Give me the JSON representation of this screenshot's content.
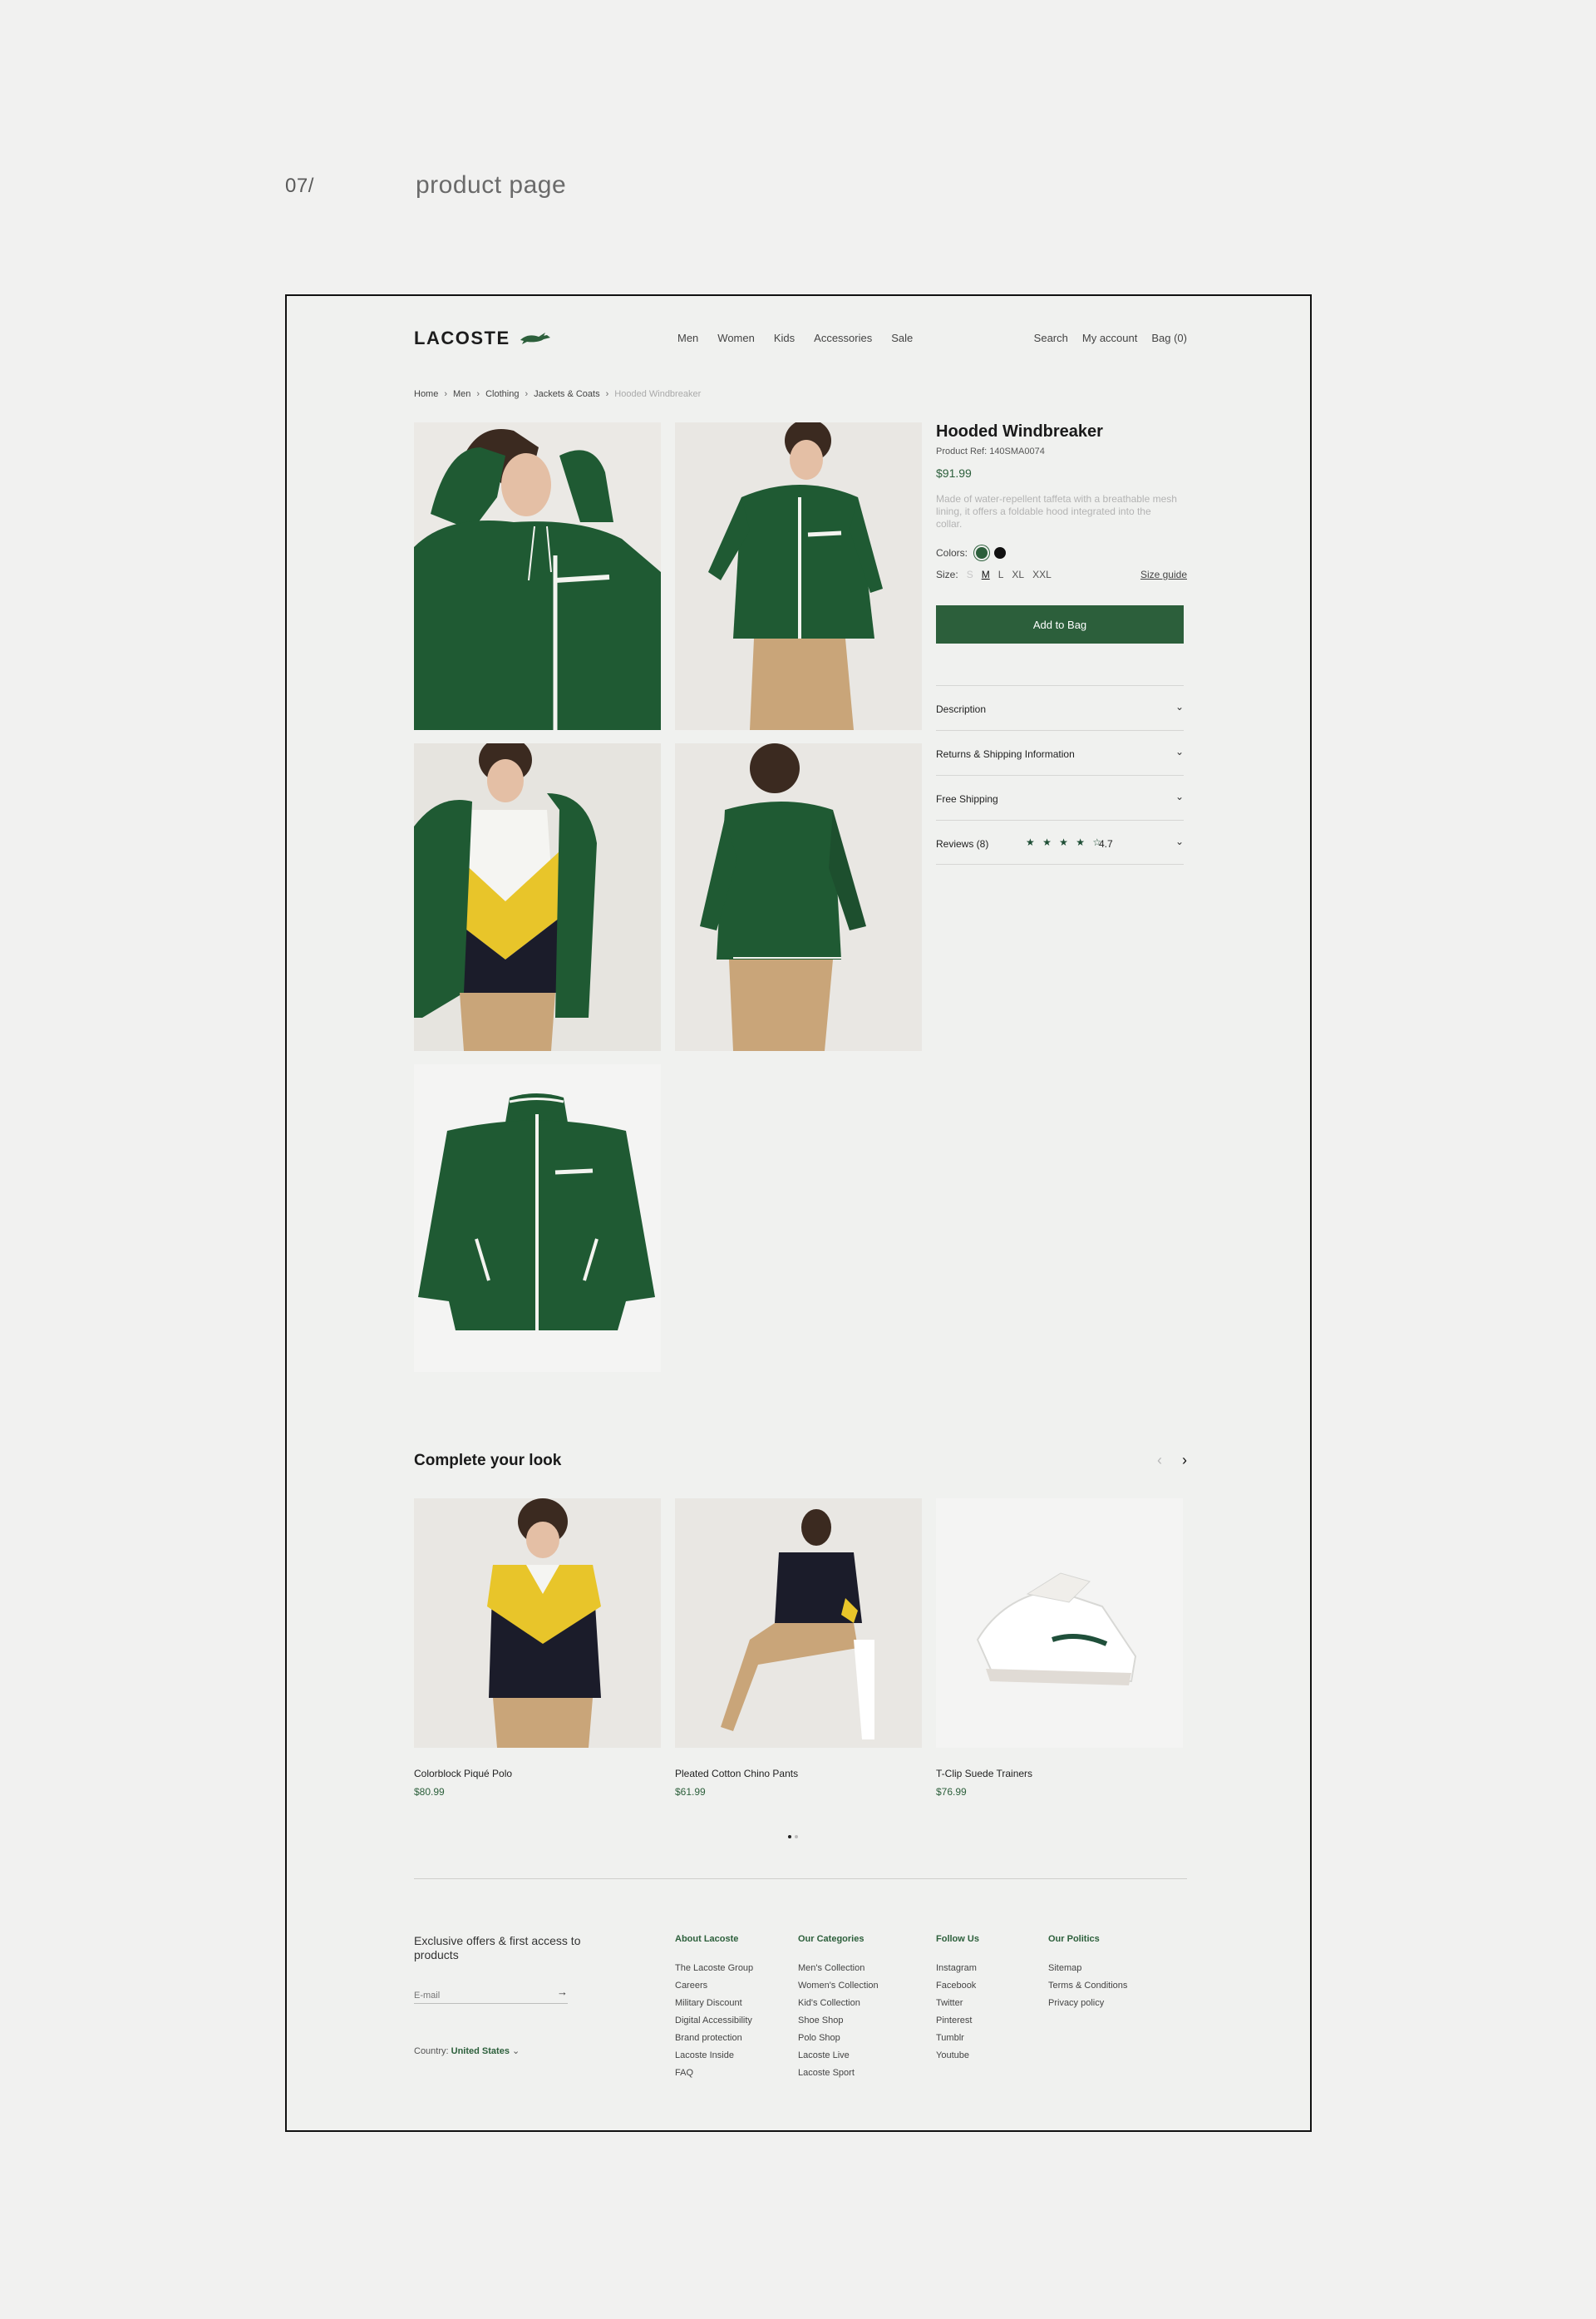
{
  "case": {
    "number": "07/",
    "label": "product page"
  },
  "header": {
    "logo": "LACOSTE",
    "nav": [
      "Men",
      "Women",
      "Kids",
      "Accessories",
      "Sale"
    ],
    "search": "Search",
    "account": "My account",
    "bag": "Bag (0)"
  },
  "breadcrumb": [
    "Home",
    "Men",
    "Clothing",
    "Jackets & Coats",
    "Hooded Windbreaker"
  ],
  "product": {
    "title": "Hooded Windbreaker",
    "ref": "Product Ref: 140SMA0074",
    "price": "$91.99",
    "description": "Made of water-repellent taffeta with a breathable mesh lining, it offers a foldable hood integrated into the collar.",
    "colors_label": "Colors:",
    "size_label": "Size:",
    "sizes": [
      "S",
      "M",
      "L",
      "XL",
      "XXL"
    ],
    "size_selected": "M",
    "size_guide": "Size guide",
    "add_to_bag": "Add to Bag"
  },
  "accordion": {
    "description": "Description",
    "returns": "Returns & Shipping Information",
    "shipping": "Free Shipping",
    "reviews": "Reviews (8)",
    "stars": "★ ★ ★ ★ ☆",
    "rating": "4.7"
  },
  "complete_look": {
    "title": "Complete your look",
    "items": [
      {
        "name": "Colorblock Piqué Polo",
        "price": "$80.99"
      },
      {
        "name": "Pleated Cotton Chino Pants",
        "price": "$61.99"
      },
      {
        "name": "T-Clip Suede Trainers",
        "price": "$76.99"
      }
    ]
  },
  "footer": {
    "newsletter": "Exclusive offers & first access to products",
    "email_placeholder": "E-mail",
    "country_label": "Country:",
    "country_value": "United States",
    "columns": [
      {
        "title": "About Lacoste",
        "links": [
          "The Lacoste Group",
          "Careers",
          "Military Discount",
          "Digital Accessibility",
          "Brand protection",
          "Lacoste Inside",
          "FAQ"
        ]
      },
      {
        "title": "Our Categories",
        "links": [
          "Men's Collection",
          "Women's Collection",
          "Kid's Collection",
          "Shoe Shop",
          "Polo Shop",
          "Lacoste Live",
          "Lacoste Sport"
        ]
      },
      {
        "title": "Follow Us",
        "links": [
          "Instagram",
          "Facebook",
          "Twitter",
          "Pinterest",
          "Tumblr",
          "Youtube"
        ]
      },
      {
        "title": "Our Politics",
        "links": [
          "Sitemap",
          "Terms & Conditions",
          "Privacy policy"
        ]
      }
    ]
  },
  "colors": {
    "brand_green": "#2c5f3b",
    "jacket_green": "#1f5a33",
    "background": "#f1f1f0"
  }
}
